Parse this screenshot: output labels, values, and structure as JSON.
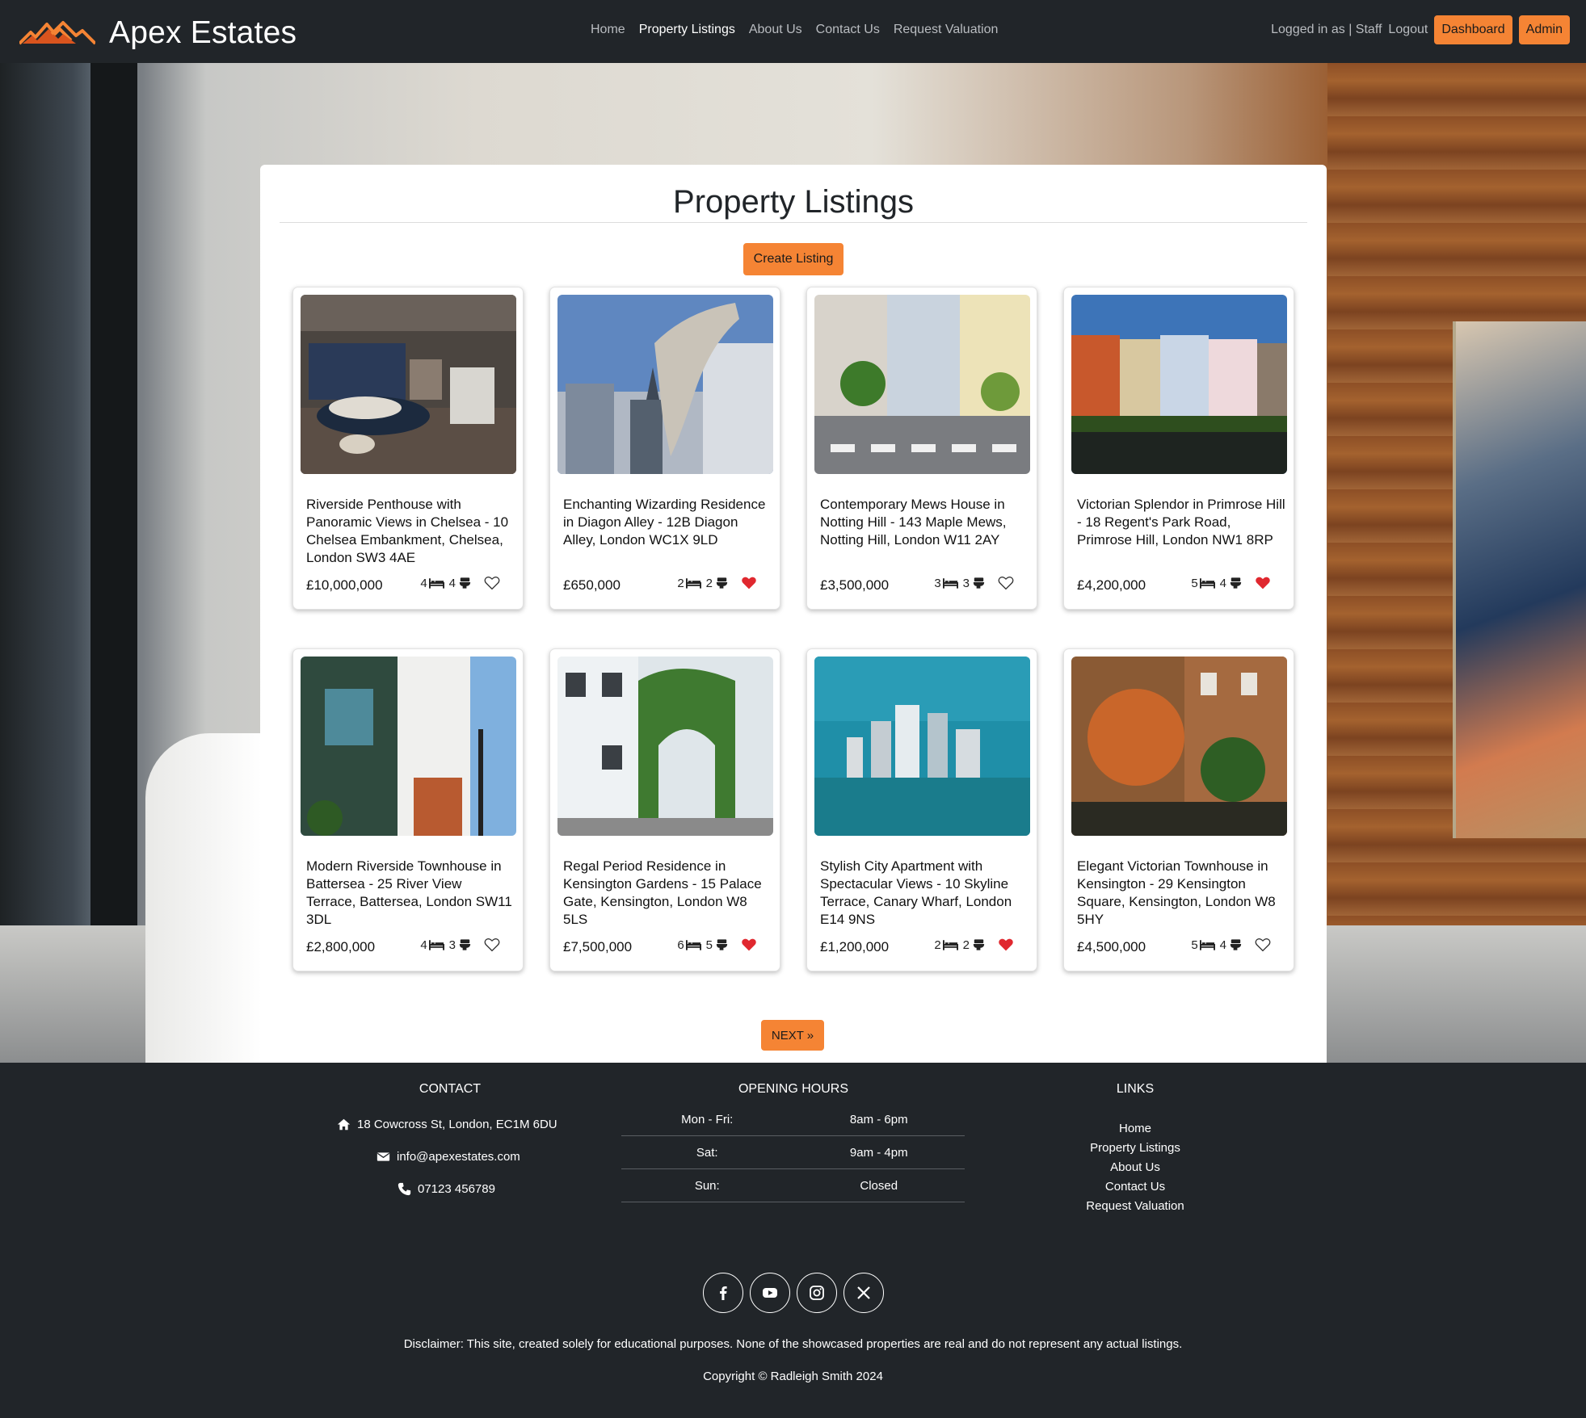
{
  "brand": {
    "name": "Apex Estates"
  },
  "nav": {
    "links": [
      {
        "label": "Home",
        "active": false
      },
      {
        "label": "Property Listings",
        "active": true
      },
      {
        "label": "About Us",
        "active": false
      },
      {
        "label": "Contact Us",
        "active": false
      },
      {
        "label": "Request Valuation",
        "active": false
      }
    ],
    "logged_in_text": "Logged in as | Staff",
    "logout_label": "Logout",
    "dashboard_label": "Dashboard",
    "admin_label": "Admin"
  },
  "main": {
    "title": "Property Listings",
    "create_label": "Create Listing",
    "next_label": "NEXT »"
  },
  "listings": [
    {
      "title": "Riverside Penthouse with Panoramic Views in Chelsea - 10 Chelsea Embankment, Chelsea, London SW3 4AE",
      "price": "£10,000,000",
      "beds": "4",
      "baths": "4",
      "favorite": false
    },
    {
      "title": "Enchanting Wizarding Residence in Diagon Alley - 12B Diagon Alley, London WC1X 9LD",
      "price": "£650,000",
      "beds": "2",
      "baths": "2",
      "favorite": true
    },
    {
      "title": "Contemporary Mews House in Notting Hill - 143 Maple Mews, Notting Hill, London W11 2AY",
      "price": "£3,500,000",
      "beds": "3",
      "baths": "3",
      "favorite": false
    },
    {
      "title": "Victorian Splendor in Primrose Hill - 18 Regent's Park Road, Primrose Hill, London NW1 8RP",
      "price": "£4,200,000",
      "beds": "5",
      "baths": "4",
      "favorite": true
    },
    {
      "title": "Modern Riverside Townhouse in Battersea - 25 River View Terrace, Battersea, London SW11 3DL",
      "price": "£2,800,000",
      "beds": "4",
      "baths": "3",
      "favorite": false
    },
    {
      "title": "Regal Period Residence in Kensington Gardens - 15 Palace Gate, Kensington, London W8 5LS",
      "price": "£7,500,000",
      "beds": "6",
      "baths": "5",
      "favorite": true
    },
    {
      "title": "Stylish City Apartment with Spectacular Views - 10 Skyline Terrace, Canary Wharf, London E14 9NS",
      "price": "£1,200,000",
      "beds": "2",
      "baths": "2",
      "favorite": true
    },
    {
      "title": "Elegant Victorian Townhouse in Kensington - 29 Kensington Square, Kensington, London W8 5HY",
      "price": "£4,500,000",
      "beds": "5",
      "baths": "4",
      "favorite": false
    }
  ],
  "footer": {
    "contact_heading": "CONTACT",
    "address": "18 Cowcross St, London, EC1M 6DU",
    "email": "info@apexestates.com",
    "phone": "07123 456789",
    "hours_heading": "OPENING HOURS",
    "hours": [
      {
        "day": "Mon - Fri:",
        "time": "8am - 6pm"
      },
      {
        "day": "Sat:",
        "time": "9am - 4pm"
      },
      {
        "day": "Sun:",
        "time": "Closed"
      }
    ],
    "links_heading": "LINKS",
    "links": [
      "Home",
      "Property Listings",
      "About Us",
      "Contact Us",
      "Request Valuation"
    ],
    "socials": [
      "facebook-icon",
      "youtube-icon",
      "instagram-icon",
      "x-icon"
    ],
    "disclaimer": "Disclaimer: This site, created solely for educational purposes. None of the showcased properties are real and do not represent any actual listings.",
    "copyright": "Copyright © Radleigh Smith 2024"
  },
  "colors": {
    "accent": "#f58434",
    "dark": "#212529",
    "heart": "#e0282f"
  }
}
